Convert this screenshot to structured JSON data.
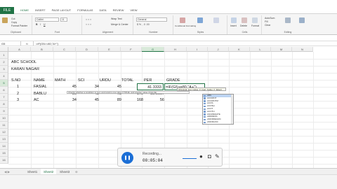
{
  "ribbon": {
    "tabs": [
      "FILE",
      "HOME",
      "INSERT",
      "PAGE LAYOUT",
      "FORMULAS",
      "DATA",
      "REVIEW",
      "VIEW"
    ],
    "active_tab": "HOME",
    "clipboard": {
      "cut": "Cut",
      "copy": "Copy",
      "format_painter": "Format Painter",
      "label": "Clipboard"
    },
    "font": {
      "name": "Calibri",
      "size": "11",
      "label": "Font"
    },
    "alignment": {
      "wrap": "Wrap Text",
      "merge": "Merge & Center",
      "label": "Alignment"
    },
    "number": {
      "format": "General",
      "label": "Number"
    },
    "styles": {
      "cond": "Conditional Formatting",
      "table": "Format as Table",
      "cell": "Cell Styles",
      "label": "Styles"
    },
    "cells": {
      "insert": "Insert",
      "delete": "Delete",
      "format": "Format",
      "label": "Cells"
    },
    "editing": {
      "autosum": "AutoSum",
      "fill": "Fill",
      "clear": "Clear",
      "sort": "Sort & Filter",
      "find": "Find & Select",
      "label": "Editing"
    },
    "accent": "#217346"
  },
  "formula_bar": {
    "namebox": "G5",
    "fx": "fx",
    "formula": "=IF(G5>=80,\"A+\")"
  },
  "columns": [
    "A",
    "B",
    "C",
    "D",
    "E",
    "F",
    "G",
    "H",
    "I",
    "J",
    "K",
    "L",
    "M",
    "N"
  ],
  "rows": [
    "1",
    "2",
    "3",
    "4",
    "5",
    "6",
    "7",
    "8",
    "9",
    "10",
    "11",
    "12",
    "13",
    "14",
    "15",
    "16"
  ],
  "sheet": {
    "A1": "ABC SCHOOL",
    "A2": "KARAN NAGAR",
    "header": {
      "sno": "S.NO",
      "name": "NAME",
      "math": "MATH",
      "sci": "SCI",
      "urdu": "URDU",
      "total": "TOTAL",
      "per": "PER",
      "grade": "GRADE"
    },
    "records": [
      {
        "sno": "1",
        "name": "FASIAL",
        "math": "45",
        "sci": "34",
        "urdu": "45",
        "total": "124",
        "per": "41.3333",
        "grade": "=IF(G5>=80,\"A+\")"
      },
      {
        "sno": "2",
        "name": "BABLU",
        "math": "56",
        "sci": "45",
        "urdu": "78",
        "total": "179",
        "per": "59.6667",
        "grade": ""
      },
      {
        "sno": "3",
        "name": "AC",
        "math": "34",
        "sci": "45",
        "urdu": "89",
        "total": "168",
        "per": "56",
        "grade": ""
      }
    ]
  },
  "tooltip_hint": "IF(logical_test, [value_if_true], [value_if_false])",
  "tooltip_desc": "Checks whether a condition is met, and returns one value if TRUE, and another value if FALSE",
  "autocomplete": [
    "ABS",
    "ACCRINT",
    "ACCRINTM",
    "ACOS",
    "ACOSH",
    "ACOT",
    "ACOTH",
    "AGGREGATE",
    "ADDRESS",
    "AMORDEGRC",
    "AMORLINC",
    "AND",
    "ARABIC",
    "AREAS",
    "ASC",
    "ASIN",
    "ASINH"
  ],
  "sheets": [
    "Sheet1",
    "Sheet2",
    "Sheet3"
  ],
  "active_sheet": "Sheet2",
  "recorder": {
    "label": "Recording...",
    "time": "00:05:04"
  }
}
